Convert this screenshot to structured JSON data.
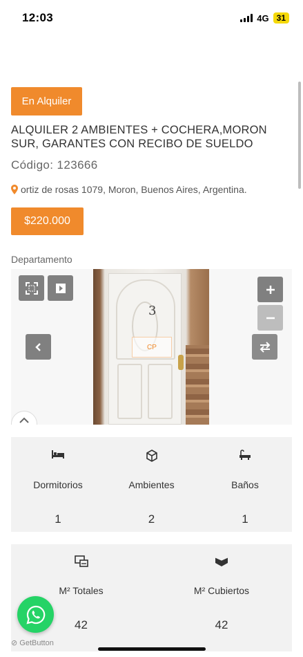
{
  "status": {
    "time": "12:03",
    "network": "4G",
    "battery": "31"
  },
  "listing": {
    "badge": "En Alquiler",
    "title": "ALQUILER 2 AMBIENTES + COCHERA,MORON SUR, GARANTES CON RECIBO DE SUELDO",
    "code_label": "Código: 123666",
    "address": "ortiz de rosas 1079, Moron, Buenos Aires, Argentina.",
    "price": "$220.000",
    "type": "Departamento"
  },
  "gallery": {
    "photo_number": "3",
    "watermark": "CP",
    "buttons": [
      "fullscreen-icon",
      "play-icon",
      "zoom-in-icon",
      "zoom-out-icon",
      "prev-icon",
      "swap-icon",
      "chevron-up-icon"
    ]
  },
  "features_1": [
    {
      "icon": "bed-icon",
      "label": "Dormitorios",
      "value": "1"
    },
    {
      "icon": "cube-icon",
      "label": "Ambientes",
      "value": "2"
    },
    {
      "icon": "bathtub-icon",
      "label": "Baños",
      "value": "1"
    }
  ],
  "features_2": [
    {
      "icon": "area-icon",
      "label": "M² Totales",
      "value": "42"
    },
    {
      "icon": "covered-area-icon",
      "label": "M² Cubiertos",
      "value": "42"
    }
  ],
  "widgets": {
    "getbutton": "GetButton"
  },
  "colors": {
    "accent": "#f08a2c",
    "whatsapp": "#25d366",
    "panel": "#f2f2f2"
  }
}
